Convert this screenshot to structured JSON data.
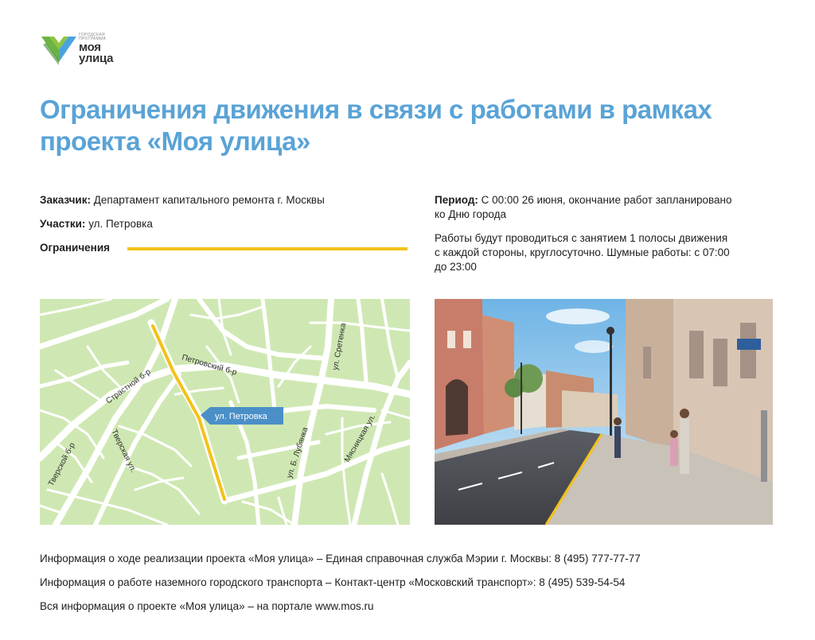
{
  "logo": {
    "small_lines": [
      "Городская",
      "программа"
    ],
    "big_lines": [
      "моя",
      "улица"
    ]
  },
  "title_lines": [
    "Ограничения движения в связи с работами в рамках",
    "проекта «Моя улица»"
  ],
  "customer": {
    "label": "Заказчик:",
    "value": "Департамент капитального ремонта г. Москвы"
  },
  "sections": {
    "label": "Участки:",
    "value": "ул. Петровка"
  },
  "restrictions": {
    "label": "Ограничения"
  },
  "period": {
    "label": "Период:",
    "value_line1": "С 00:00 26 июня, окончание работ запланировано",
    "value_line2": "ко Дню города"
  },
  "works_lines": [
    "Работы будут проводиться с занятием 1 полосы движения",
    "с каждой стороны, круглосуточно. Шумные работы: с 07:00",
    "до 23:00"
  ],
  "map": {
    "street_labels": {
      "petrovsky": "Петровский б-р",
      "strastnoy": "Страстной б-р",
      "tverskoy": "Тверской б-р",
      "tverskaya": "Тверская ул.",
      "sretenka": "ул. Сретенка",
      "lubyanka": "ул. Б. Лубянка",
      "myasnitskaya": "Мясницкая ул."
    },
    "callout": "ул. Петровка",
    "colors": {
      "background": "#cfe8b3",
      "roads": "#ffffff",
      "highlight": "#f4c11a",
      "callout": "#4a8fc8"
    }
  },
  "footer_lines": [
    "Информация о ходе реализации проекта «Моя улица» – Единая справочная служба Мэрии г. Москвы: 8 (495) 777-77-77",
    "Информация о работе наземного городского транспорта – Контакт-центр «Московский транспорт»: 8 (495) 539-54-54",
    "Вся информация о проекте «Моя улица» – на портале www.mos.ru"
  ],
  "colors": {
    "accent": "#5aa3d6",
    "restriction_line": "#f4c11a"
  }
}
